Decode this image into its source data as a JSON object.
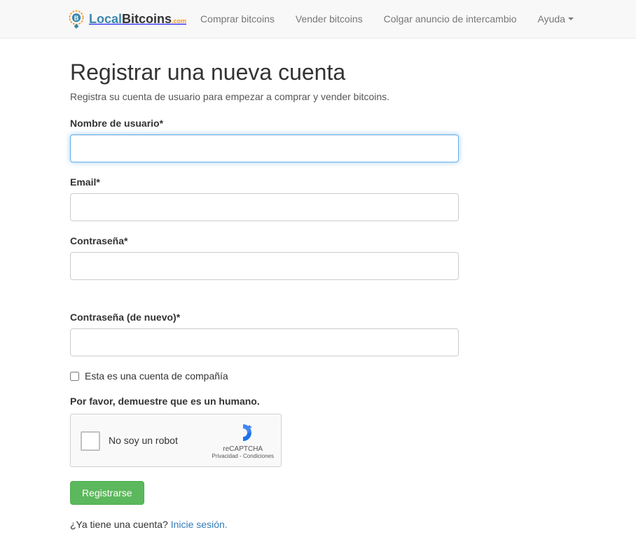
{
  "logo": {
    "local": "Local",
    "bitcoins": "Bitcoins",
    "com": ".com"
  },
  "nav": {
    "buy": "Comprar bitcoins",
    "sell": "Vender bitcoins",
    "post": "Colgar anuncio de intercambio",
    "help": "Ayuda"
  },
  "page": {
    "title": "Registrar una nueva cuenta",
    "subtitle": "Registra su cuenta de usuario para empezar a comprar y vender bitcoins."
  },
  "form": {
    "username_label": "Nombre de usuario*",
    "email_label": "Email*",
    "password_label": "Contraseña*",
    "password_again_label": "Contraseña (de nuevo)*",
    "company_checkbox_label": "Esta es una cuenta de compañía",
    "captcha_label": "Por favor, demuestre que es un humano.",
    "submit_label": "Registrarse"
  },
  "recaptcha": {
    "text": "No soy un robot",
    "brand": "reCAPTCHA",
    "links": "Privacidad - Condiciones"
  },
  "login": {
    "prompt": "¿Ya tiene una cuenta? ",
    "link": "Inicie sesión."
  }
}
